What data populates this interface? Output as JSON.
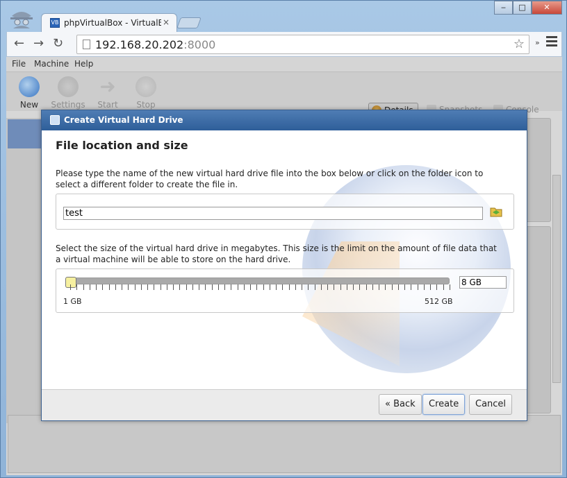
{
  "browser": {
    "tab_title": "phpVirtualBox - VirtualBo",
    "tab_close": "×",
    "url_host": "192.168.20.202",
    "url_port": ":8000",
    "nav": {
      "back": "←",
      "forward": "→",
      "reload": "↻"
    },
    "overflow": "»",
    "window_buttons": {
      "minimize": "‒",
      "maximize": "□",
      "close": "✕"
    }
  },
  "app": {
    "menu": [
      "File",
      "Machine",
      "Help"
    ],
    "toolbar": {
      "new": "New",
      "settings": "Settings",
      "start": "Start",
      "stop": "Stop"
    },
    "view_tabs": {
      "details": "Details",
      "snapshots": "Snapshots",
      "console": "Console"
    }
  },
  "dialog": {
    "title": "Create Virtual Hard Drive",
    "heading": "File location and size",
    "file_description": "Please type the name of the new virtual hard drive file into the box below or click on the folder icon to select a different folder to create the file in.",
    "file_name": "test",
    "size_description": "Select the size of the virtual hard drive in megabytes. This size is the limit on the amount of file data that a virtual machine will be able to store on the hard drive.",
    "slider": {
      "min_label": "1 GB",
      "max_label": "512 GB",
      "value_fraction": 0.0
    },
    "size_value": "8 GB",
    "buttons": {
      "back": "« Back",
      "create": "Create",
      "cancel": "Cancel"
    }
  }
}
